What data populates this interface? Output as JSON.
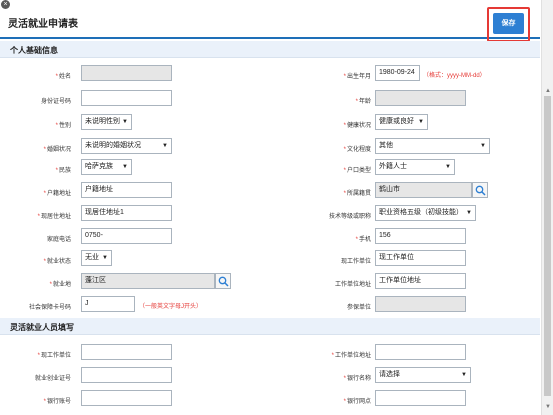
{
  "header": {
    "title": "灵活就业申请表",
    "save_label": "保存",
    "close_glyph": "×"
  },
  "sections": {
    "basic": "个人基础信息",
    "flex": "灵活就业人员填写"
  },
  "fields": {
    "name": {
      "label": "姓名",
      "value": ""
    },
    "birth": {
      "label": "出生年月",
      "value": "1980-09-24",
      "hint": "（格式：yyyy-MM-dd）"
    },
    "idcard": {
      "label": "身份证号码",
      "value": ""
    },
    "age": {
      "label": "年龄",
      "value": ""
    },
    "gender": {
      "label": "性别",
      "value": "未说明性别"
    },
    "health": {
      "label": "健康状况",
      "value": "健康或良好"
    },
    "marital": {
      "label": "婚姻状况",
      "value": "未说明的婚姻状况"
    },
    "education": {
      "label": "文化程度",
      "value": "其他"
    },
    "ethnic": {
      "label": "民族",
      "value": "哈萨克族"
    },
    "hukou_type": {
      "label": "户口类型",
      "value": "外籍人士"
    },
    "hukou_addr": {
      "label": "户籍地址",
      "value": "户籍地址"
    },
    "origin": {
      "label": "所属籍贯",
      "value": "鹤山市"
    },
    "residence": {
      "label": "现居住地址",
      "value": "现居住地址1"
    },
    "skill": {
      "label": "技术等级或职称",
      "value": "职业资格五级（初级技能）"
    },
    "home_phone": {
      "label": "家庭电话",
      "value": "0750-"
    },
    "mobile": {
      "label": "手机",
      "value": "156"
    },
    "emp_status": {
      "label": "就业状态",
      "value": "无业"
    },
    "work_unit": {
      "label": "现工作单位",
      "value": "现工作单位"
    },
    "emp_place": {
      "label": "就业地",
      "value": "蓬江区"
    },
    "unit_addr": {
      "label": "工作单位地址",
      "value": "工作单位地址"
    },
    "ssn": {
      "label": "社会保障卡号码",
      "value": "J",
      "hint": "（一般英文字母J开头）"
    },
    "insured_unit": {
      "label": "参保单位",
      "value": ""
    },
    "flex_unit": {
      "label": "现工作单位",
      "value": ""
    },
    "flex_unit_addr": {
      "label": "工作单位地址",
      "value": ""
    },
    "entrepreneur": {
      "label": "就业创业证号",
      "value": ""
    },
    "bank": {
      "label": "银行名称",
      "value": "请选择"
    },
    "bank_acct": {
      "label": "银行账号",
      "value": ""
    },
    "bank_branch": {
      "label": "银行网点",
      "value": ""
    }
  },
  "scrollbar": {
    "up": "▲",
    "down": "▼"
  },
  "select_arrow": "▼"
}
